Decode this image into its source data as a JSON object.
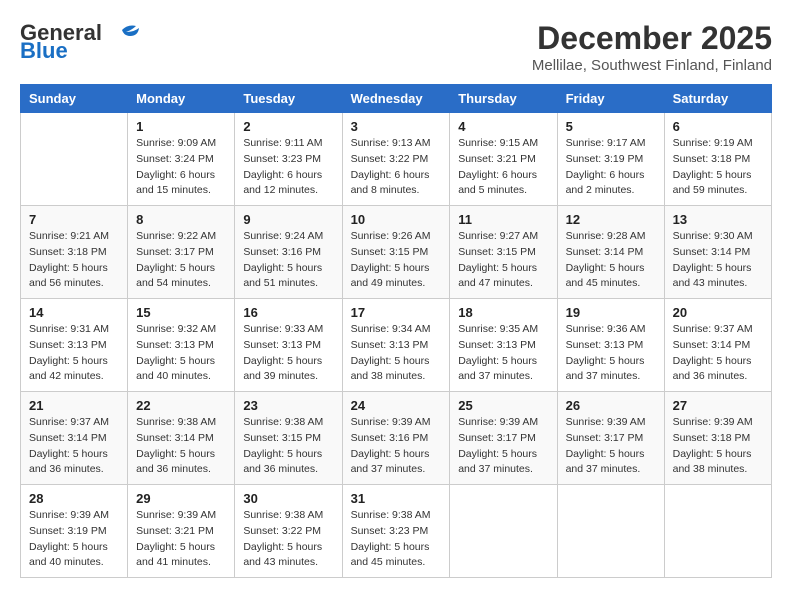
{
  "logo": {
    "general": "General",
    "blue": "Blue"
  },
  "header": {
    "month": "December 2025",
    "location": "Mellilae, Southwest Finland, Finland"
  },
  "weekdays": [
    "Sunday",
    "Monday",
    "Tuesday",
    "Wednesday",
    "Thursday",
    "Friday",
    "Saturday"
  ],
  "weeks": [
    [
      {
        "day": "",
        "sunrise": "",
        "sunset": "",
        "daylight": ""
      },
      {
        "day": "1",
        "sunrise": "Sunrise: 9:09 AM",
        "sunset": "Sunset: 3:24 PM",
        "daylight": "Daylight: 6 hours and 15 minutes."
      },
      {
        "day": "2",
        "sunrise": "Sunrise: 9:11 AM",
        "sunset": "Sunset: 3:23 PM",
        "daylight": "Daylight: 6 hours and 12 minutes."
      },
      {
        "day": "3",
        "sunrise": "Sunrise: 9:13 AM",
        "sunset": "Sunset: 3:22 PM",
        "daylight": "Daylight: 6 hours and 8 minutes."
      },
      {
        "day": "4",
        "sunrise": "Sunrise: 9:15 AM",
        "sunset": "Sunset: 3:21 PM",
        "daylight": "Daylight: 6 hours and 5 minutes."
      },
      {
        "day": "5",
        "sunrise": "Sunrise: 9:17 AM",
        "sunset": "Sunset: 3:19 PM",
        "daylight": "Daylight: 6 hours and 2 minutes."
      },
      {
        "day": "6",
        "sunrise": "Sunrise: 9:19 AM",
        "sunset": "Sunset: 3:18 PM",
        "daylight": "Daylight: 5 hours and 59 minutes."
      }
    ],
    [
      {
        "day": "7",
        "sunrise": "Sunrise: 9:21 AM",
        "sunset": "Sunset: 3:18 PM",
        "daylight": "Daylight: 5 hours and 56 minutes."
      },
      {
        "day": "8",
        "sunrise": "Sunrise: 9:22 AM",
        "sunset": "Sunset: 3:17 PM",
        "daylight": "Daylight: 5 hours and 54 minutes."
      },
      {
        "day": "9",
        "sunrise": "Sunrise: 9:24 AM",
        "sunset": "Sunset: 3:16 PM",
        "daylight": "Daylight: 5 hours and 51 minutes."
      },
      {
        "day": "10",
        "sunrise": "Sunrise: 9:26 AM",
        "sunset": "Sunset: 3:15 PM",
        "daylight": "Daylight: 5 hours and 49 minutes."
      },
      {
        "day": "11",
        "sunrise": "Sunrise: 9:27 AM",
        "sunset": "Sunset: 3:15 PM",
        "daylight": "Daylight: 5 hours and 47 minutes."
      },
      {
        "day": "12",
        "sunrise": "Sunrise: 9:28 AM",
        "sunset": "Sunset: 3:14 PM",
        "daylight": "Daylight: 5 hours and 45 minutes."
      },
      {
        "day": "13",
        "sunrise": "Sunrise: 9:30 AM",
        "sunset": "Sunset: 3:14 PM",
        "daylight": "Daylight: 5 hours and 43 minutes."
      }
    ],
    [
      {
        "day": "14",
        "sunrise": "Sunrise: 9:31 AM",
        "sunset": "Sunset: 3:13 PM",
        "daylight": "Daylight: 5 hours and 42 minutes."
      },
      {
        "day": "15",
        "sunrise": "Sunrise: 9:32 AM",
        "sunset": "Sunset: 3:13 PM",
        "daylight": "Daylight: 5 hours and 40 minutes."
      },
      {
        "day": "16",
        "sunrise": "Sunrise: 9:33 AM",
        "sunset": "Sunset: 3:13 PM",
        "daylight": "Daylight: 5 hours and 39 minutes."
      },
      {
        "day": "17",
        "sunrise": "Sunrise: 9:34 AM",
        "sunset": "Sunset: 3:13 PM",
        "daylight": "Daylight: 5 hours and 38 minutes."
      },
      {
        "day": "18",
        "sunrise": "Sunrise: 9:35 AM",
        "sunset": "Sunset: 3:13 PM",
        "daylight": "Daylight: 5 hours and 37 minutes."
      },
      {
        "day": "19",
        "sunrise": "Sunrise: 9:36 AM",
        "sunset": "Sunset: 3:13 PM",
        "daylight": "Daylight: 5 hours and 37 minutes."
      },
      {
        "day": "20",
        "sunrise": "Sunrise: 9:37 AM",
        "sunset": "Sunset: 3:14 PM",
        "daylight": "Daylight: 5 hours and 36 minutes."
      }
    ],
    [
      {
        "day": "21",
        "sunrise": "Sunrise: 9:37 AM",
        "sunset": "Sunset: 3:14 PM",
        "daylight": "Daylight: 5 hours and 36 minutes."
      },
      {
        "day": "22",
        "sunrise": "Sunrise: 9:38 AM",
        "sunset": "Sunset: 3:14 PM",
        "daylight": "Daylight: 5 hours and 36 minutes."
      },
      {
        "day": "23",
        "sunrise": "Sunrise: 9:38 AM",
        "sunset": "Sunset: 3:15 PM",
        "daylight": "Daylight: 5 hours and 36 minutes."
      },
      {
        "day": "24",
        "sunrise": "Sunrise: 9:39 AM",
        "sunset": "Sunset: 3:16 PM",
        "daylight": "Daylight: 5 hours and 37 minutes."
      },
      {
        "day": "25",
        "sunrise": "Sunrise: 9:39 AM",
        "sunset": "Sunset: 3:17 PM",
        "daylight": "Daylight: 5 hours and 37 minutes."
      },
      {
        "day": "26",
        "sunrise": "Sunrise: 9:39 AM",
        "sunset": "Sunset: 3:17 PM",
        "daylight": "Daylight: 5 hours and 37 minutes."
      },
      {
        "day": "27",
        "sunrise": "Sunrise: 9:39 AM",
        "sunset": "Sunset: 3:18 PM",
        "daylight": "Daylight: 5 hours and 38 minutes."
      }
    ],
    [
      {
        "day": "28",
        "sunrise": "Sunrise: 9:39 AM",
        "sunset": "Sunset: 3:19 PM",
        "daylight": "Daylight: 5 hours and 40 minutes."
      },
      {
        "day": "29",
        "sunrise": "Sunrise: 9:39 AM",
        "sunset": "Sunset: 3:21 PM",
        "daylight": "Daylight: 5 hours and 41 minutes."
      },
      {
        "day": "30",
        "sunrise": "Sunrise: 9:38 AM",
        "sunset": "Sunset: 3:22 PM",
        "daylight": "Daylight: 5 hours and 43 minutes."
      },
      {
        "day": "31",
        "sunrise": "Sunrise: 9:38 AM",
        "sunset": "Sunset: 3:23 PM",
        "daylight": "Daylight: 5 hours and 45 minutes."
      },
      {
        "day": "",
        "sunrise": "",
        "sunset": "",
        "daylight": ""
      },
      {
        "day": "",
        "sunrise": "",
        "sunset": "",
        "daylight": ""
      },
      {
        "day": "",
        "sunrise": "",
        "sunset": "",
        "daylight": ""
      }
    ]
  ]
}
